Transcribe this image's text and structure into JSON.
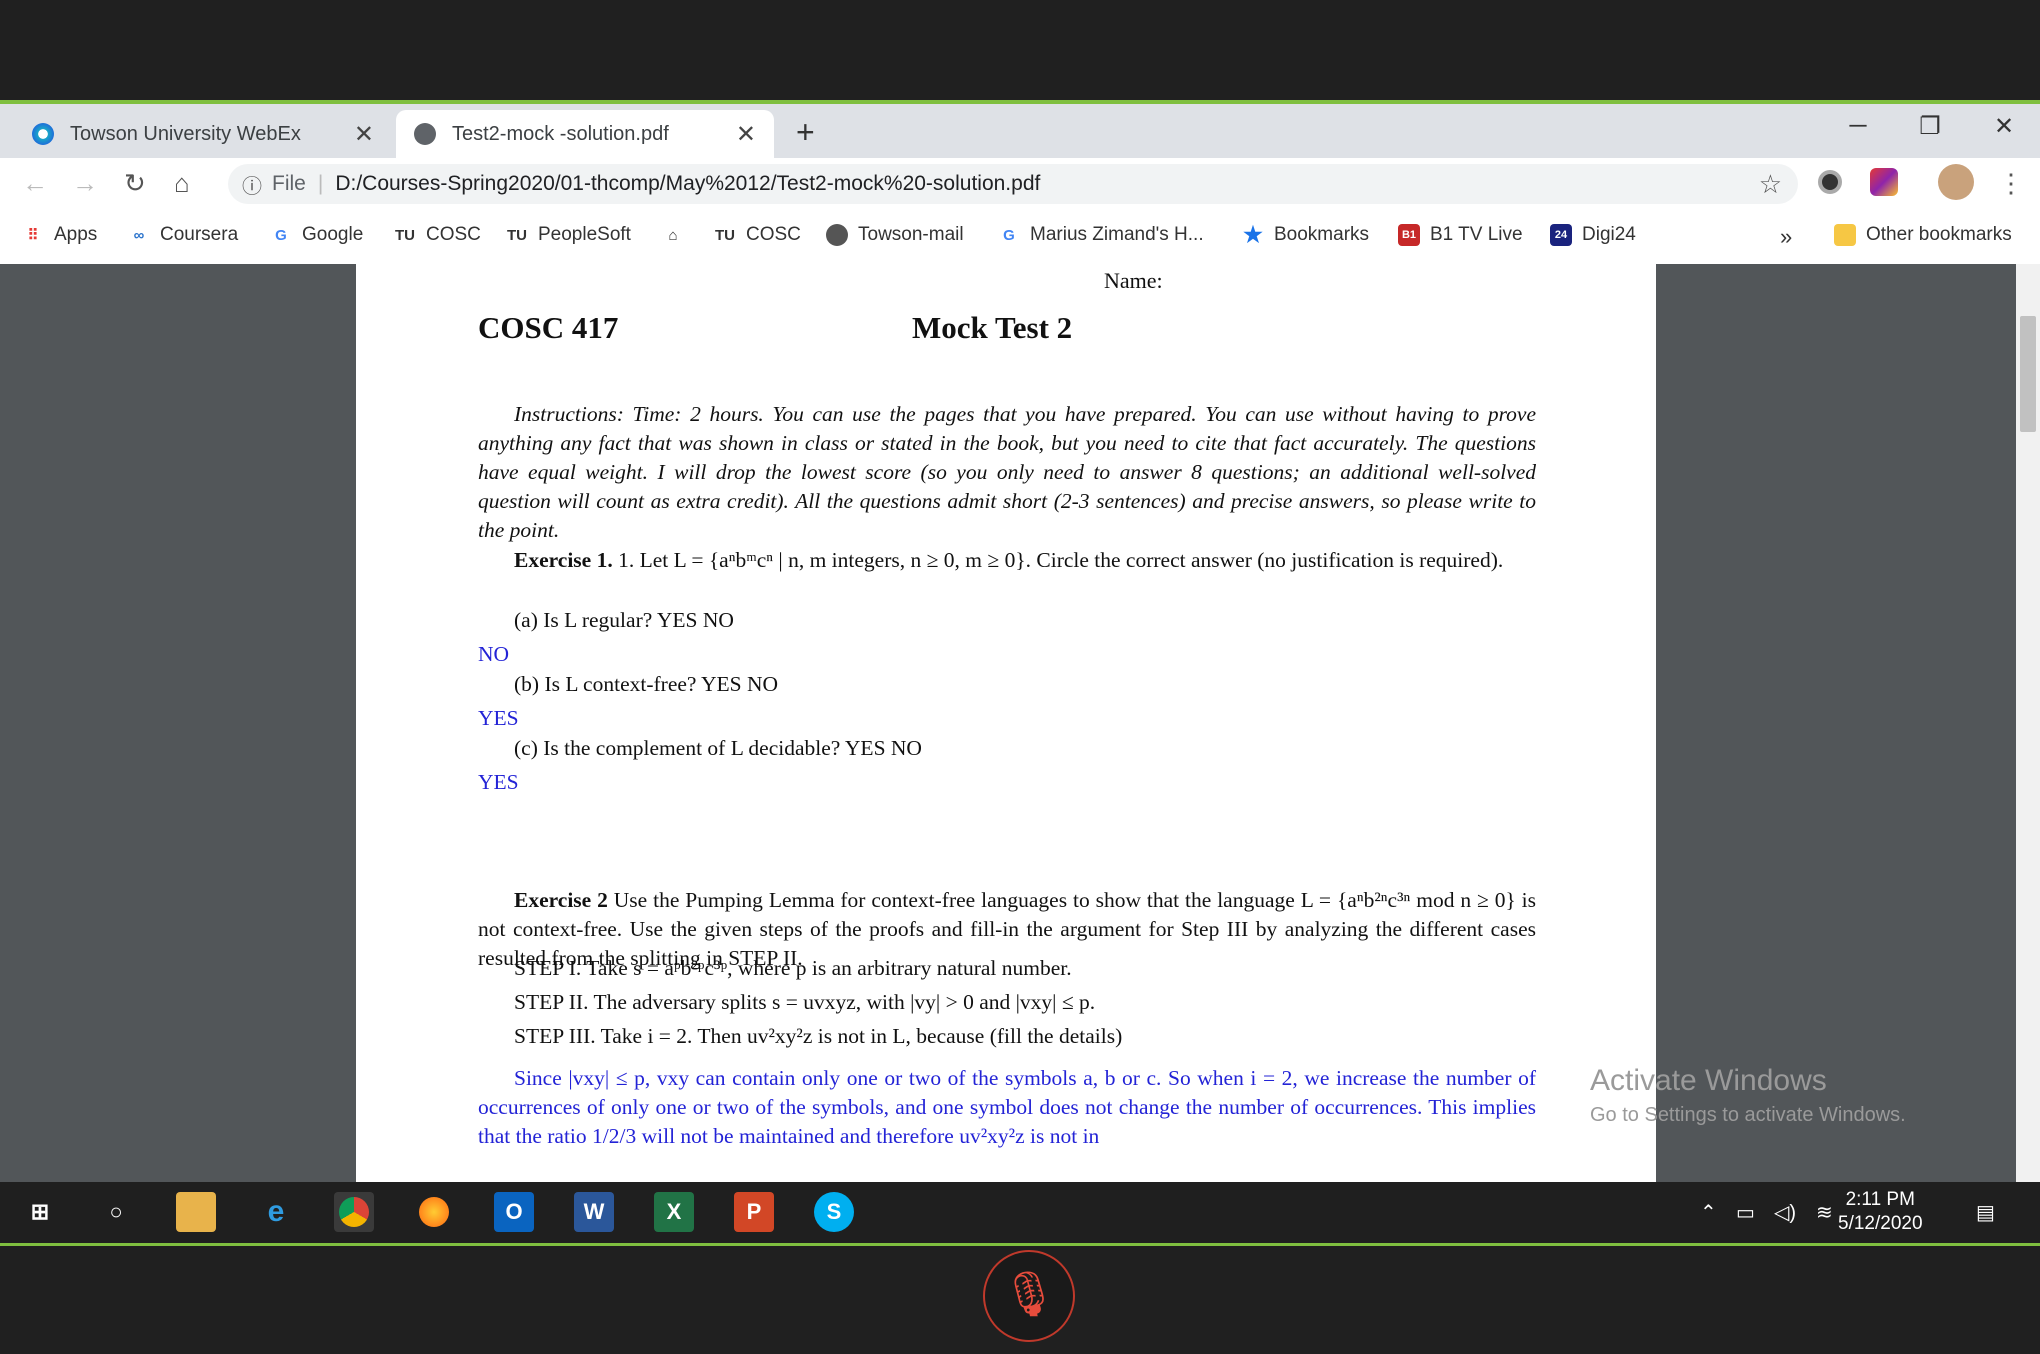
{
  "browser": {
    "tabs": [
      {
        "label": "Towson University WebEx",
        "active": false
      },
      {
        "label": "Test2-mock -solution.pdf",
        "active": true
      }
    ],
    "new_tab": "+",
    "url_prefix": "File",
    "url": "D:/Courses-Spring2020/01-thcomp/May%2012/Test2-mock%20-solution.pdf",
    "bookmarks": [
      "Apps",
      "Coursera",
      "Google",
      "COSC",
      "PeopleSoft",
      "COSC",
      "Towson-mail",
      "Marius Zimand's H...",
      "Bookmarks",
      "B1 TV Live",
      "Digi24"
    ],
    "more_bookmarks": "»",
    "other_bookmarks": "Other bookmarks"
  },
  "pdf": {
    "name_label": "Name:",
    "course": "COSC 417",
    "title": "Mock Test 2",
    "instructions": "Instructions: Time: 2 hours. You can use the pages that you have prepared. You can use without having to prove anything any fact that was shown in class or stated in the book, but you need to cite that fact accurately. The questions have equal weight. I will drop the lowest score (so you only need to answer 8 questions; an additional well-solved question will count as extra credit). All the questions admit short (2-3 sentences) and precise answers, so please write to the point.",
    "ex1_heading": "Exercise 1.",
    "ex1_text": " 1. Let L = {aⁿbᵐcⁿ | n, m integers, n ≥ 0, m ≥ 0}. Circle the correct answer (no justification is required).",
    "q_a": "(a) Is L regular? YES NO",
    "ans_a": "NO",
    "q_b": "(b) Is L context-free? YES NO",
    "ans_b": "YES",
    "q_c": "(c) Is the complement of L decidable? YES NO",
    "ans_c": "YES",
    "ex2_heading": "Exercise 2",
    "ex2_text": " Use the Pumping Lemma for context-free languages to show that the language L = {aⁿb²ⁿc³ⁿ mod n ≥ 0} is not context-free. Use the given steps of the proofs and fill-in the argument for Step III by analyzing the different cases resulted from the splitting in STEP II.",
    "step1": "STEP I. Take s = aᵖb²ᵖc³ᵖ, where p is an arbitrary natural number.",
    "step2": "STEP II. The adversary splits s = uvxyz, with |vy| > 0 and |vxy| ≤ p.",
    "step3": "STEP III. Take i = 2. Then uv²xy²z is not in L, because (fill the details)",
    "solution": "Since |vxy| ≤ p, vxy can contain only one or two of the symbols a, b or c. So when i = 2, we increase the number of occurrences of only one or two of the symbols, and one symbol does not change the number of occurrences. This implies that the ratio 1/2/3 will not be maintained and therefore uv²xy²z is not in"
  },
  "watermark": {
    "line1": "Activate Windows",
    "line2": "Go to Settings to activate Windows."
  },
  "taskbar": {
    "time": "2:11 PM",
    "date": "5/12/2020"
  }
}
